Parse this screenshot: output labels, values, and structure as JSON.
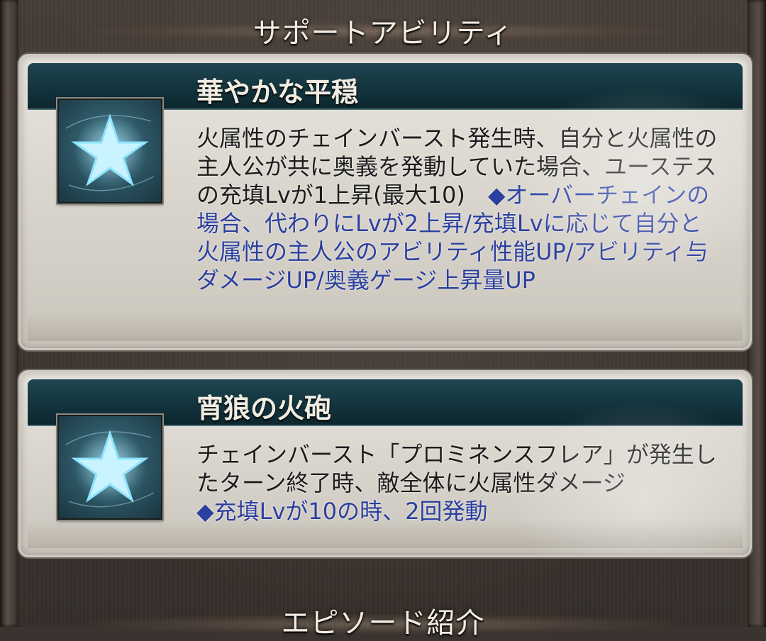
{
  "sections": {
    "support_title": "サポートアビリティ",
    "episode_title": "エピソード紹介"
  },
  "abilities": [
    {
      "name": "華やかな平穏",
      "icon": "star-icon",
      "desc_normal": "火属性のチェインバースト発生時、自分と火属性の主人公が共に奥義を発動していた場合、ユーステスの充填Lvが1上昇(最大10)　",
      "desc_blue": "◆オーバーチェインの場合、代わりにLvが2上昇/充填Lvに応じて自分と火属性の主人公のアビリティ性能UP/アビリティ与ダメージUP/奥義ゲージ上昇量UP"
    },
    {
      "name": "宵狼の火砲",
      "icon": "star-icon",
      "desc_normal": "チェインバースト「プロミネンスフレア」が発生したターン終了時、敵全体に火属性ダメージ",
      "desc_blue": "◆充填Lvが10の時、2回発動"
    }
  ],
  "colors": {
    "header": "#12323b",
    "highlight_text": "#2b3f9e",
    "body_text": "#1c1c1c"
  }
}
